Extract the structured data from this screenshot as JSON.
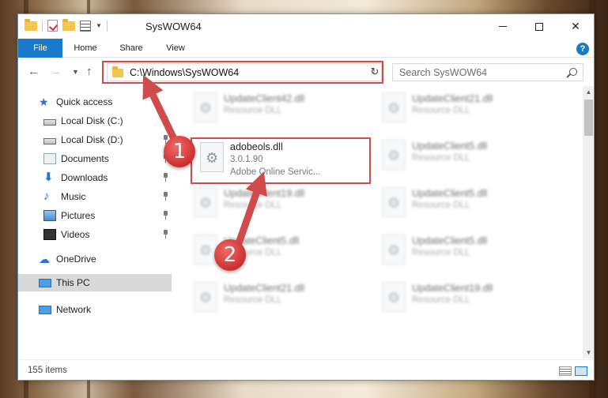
{
  "window": {
    "title": "SysWOW64",
    "controls": {
      "minimize": "—",
      "maximize": "□",
      "close": "✕"
    }
  },
  "ribbon": {
    "tabs": [
      "File",
      "Home",
      "Share",
      "View"
    ],
    "help": "?"
  },
  "address": {
    "path": "C:\\Windows\\SysWOW64"
  },
  "search": {
    "placeholder": "Search SysWOW64"
  },
  "sidebar": {
    "items": [
      {
        "label": "Quick access",
        "icon": "star-icon"
      },
      {
        "label": "Local Disk (C:)",
        "icon": "disk-icon",
        "pinned": true
      },
      {
        "label": "Local Disk (D:)",
        "icon": "disk-icon",
        "pinned": true
      },
      {
        "label": "Documents",
        "icon": "documents-icon",
        "pinned": true
      },
      {
        "label": "Downloads",
        "icon": "download-icon",
        "pinned": true
      },
      {
        "label": "Music",
        "icon": "music-icon",
        "pinned": true
      },
      {
        "label": "Pictures",
        "icon": "pictures-icon",
        "pinned": true
      },
      {
        "label": "Videos",
        "icon": "videos-icon",
        "pinned": true
      },
      {
        "label": "OneDrive",
        "icon": "cloud-icon"
      },
      {
        "label": "This PC",
        "icon": "computer-icon",
        "selected": true
      },
      {
        "label": "Network",
        "icon": "network-icon"
      }
    ]
  },
  "files": {
    "highlighted": {
      "name": "adobeols.dll",
      "version": "3.0.1.90",
      "description": "Adobe Online Servic..."
    },
    "left_column": [
      {
        "name": "UpdateClient42.dll",
        "type": "Resource DLL"
      },
      {
        "name": "UpdateClient19.dll",
        "type": "Resource DLL"
      },
      {
        "name": "UpdateClient5.dll",
        "type": "Resource DLL"
      },
      {
        "name": "UpdateClient21.dll",
        "type": "Resource DLL"
      }
    ],
    "right_column": [
      {
        "name": "UpdateClient21.dll",
        "type": "Resource DLL"
      },
      {
        "name": "UpdateClient5.dll",
        "type": "Resource DLL"
      },
      {
        "name": "UpdateClient5.dll",
        "type": "Resource DLL"
      },
      {
        "name": "UpdateClient5.dll",
        "type": "Resource DLL"
      },
      {
        "name": "UpdateClient19.dll",
        "type": "Resource DLL"
      }
    ]
  },
  "status": {
    "items_count": "155 items"
  },
  "annotations": {
    "callout_1": "1",
    "callout_2": "2",
    "color": "#d24b4b"
  }
}
